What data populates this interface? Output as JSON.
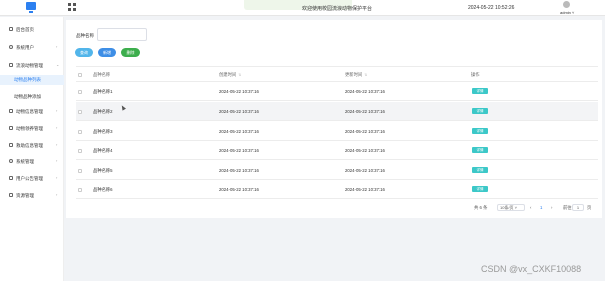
{
  "header": {
    "notice": "",
    "welcome": "欢迎使用校园流浪动物保护平台",
    "datetime": "2024-05-22 10:52:26",
    "user": "admin"
  },
  "sidebar": {
    "items": [
      {
        "label": "后台首页",
        "icon": "home-icon"
      },
      {
        "label": "系统用户",
        "icon": "user-icon",
        "chevron": "›"
      },
      {
        "label": "流浪动物管理",
        "icon": "grid-icon",
        "chevron": "⌄"
      },
      {
        "label": "动物信息管理",
        "icon": "grid-icon",
        "chevron": "›"
      },
      {
        "label": "动物领养管理",
        "icon": "grid-icon",
        "chevron": "›"
      },
      {
        "label": "救助信息管理",
        "icon": "grid-icon",
        "chevron": "›"
      },
      {
        "label": "系统管理",
        "icon": "gear-icon",
        "chevron": "›"
      },
      {
        "label": "用户公告管理",
        "icon": "grid-icon",
        "chevron": "›"
      },
      {
        "label": "资源管理",
        "icon": "grid-icon",
        "chevron": "›"
      }
    ],
    "subs": [
      {
        "label": "动物品种列表"
      },
      {
        "label": "动物品种添加"
      }
    ]
  },
  "search": {
    "label": "品种名称",
    "value": "",
    "placeholder": ""
  },
  "buttons": {
    "query": "查询",
    "add": "新增",
    "delete": "删除"
  },
  "table": {
    "headers": [
      "品种名称",
      "创建时间",
      "更新时间",
      "操作"
    ],
    "rows": [
      {
        "name": "品种名称1",
        "created": "2024-05-22 10:37:16",
        "updated": "2024-05-22 10:37:16",
        "action": "详情"
      },
      {
        "name": "品种名称2",
        "created": "2024-05-22 10:37:16",
        "updated": "2024-05-22 10:37:16",
        "action": "详情"
      },
      {
        "name": "品种名称3",
        "created": "2024-05-22 10:37:16",
        "updated": "2024-05-22 10:37:16",
        "action": "详情"
      },
      {
        "name": "品种名称4",
        "created": "2024-05-22 10:37:16",
        "updated": "2024-05-22 10:37:16",
        "action": "详情"
      },
      {
        "name": "品种名称5",
        "created": "2024-05-22 10:37:16",
        "updated": "2024-05-22 10:37:16",
        "action": "详情"
      },
      {
        "name": "品种名称6",
        "created": "2024-05-22 10:37:16",
        "updated": "2024-05-22 10:37:16",
        "action": "详情"
      }
    ]
  },
  "pagination": {
    "total": "共 6 条",
    "page_size": "10条/页",
    "prev": "‹",
    "current": "1",
    "next": "›",
    "goto_label": "前往",
    "goto_value": "1",
    "page_unit": "页"
  },
  "watermark": "CSDN @vx_CXKF10088",
  "colors": {
    "primary": "#2c80f0",
    "query": "#52b5ea",
    "add": "#3e8ee6",
    "delete": "#3dae4d",
    "detail": "#3cc8c8"
  }
}
